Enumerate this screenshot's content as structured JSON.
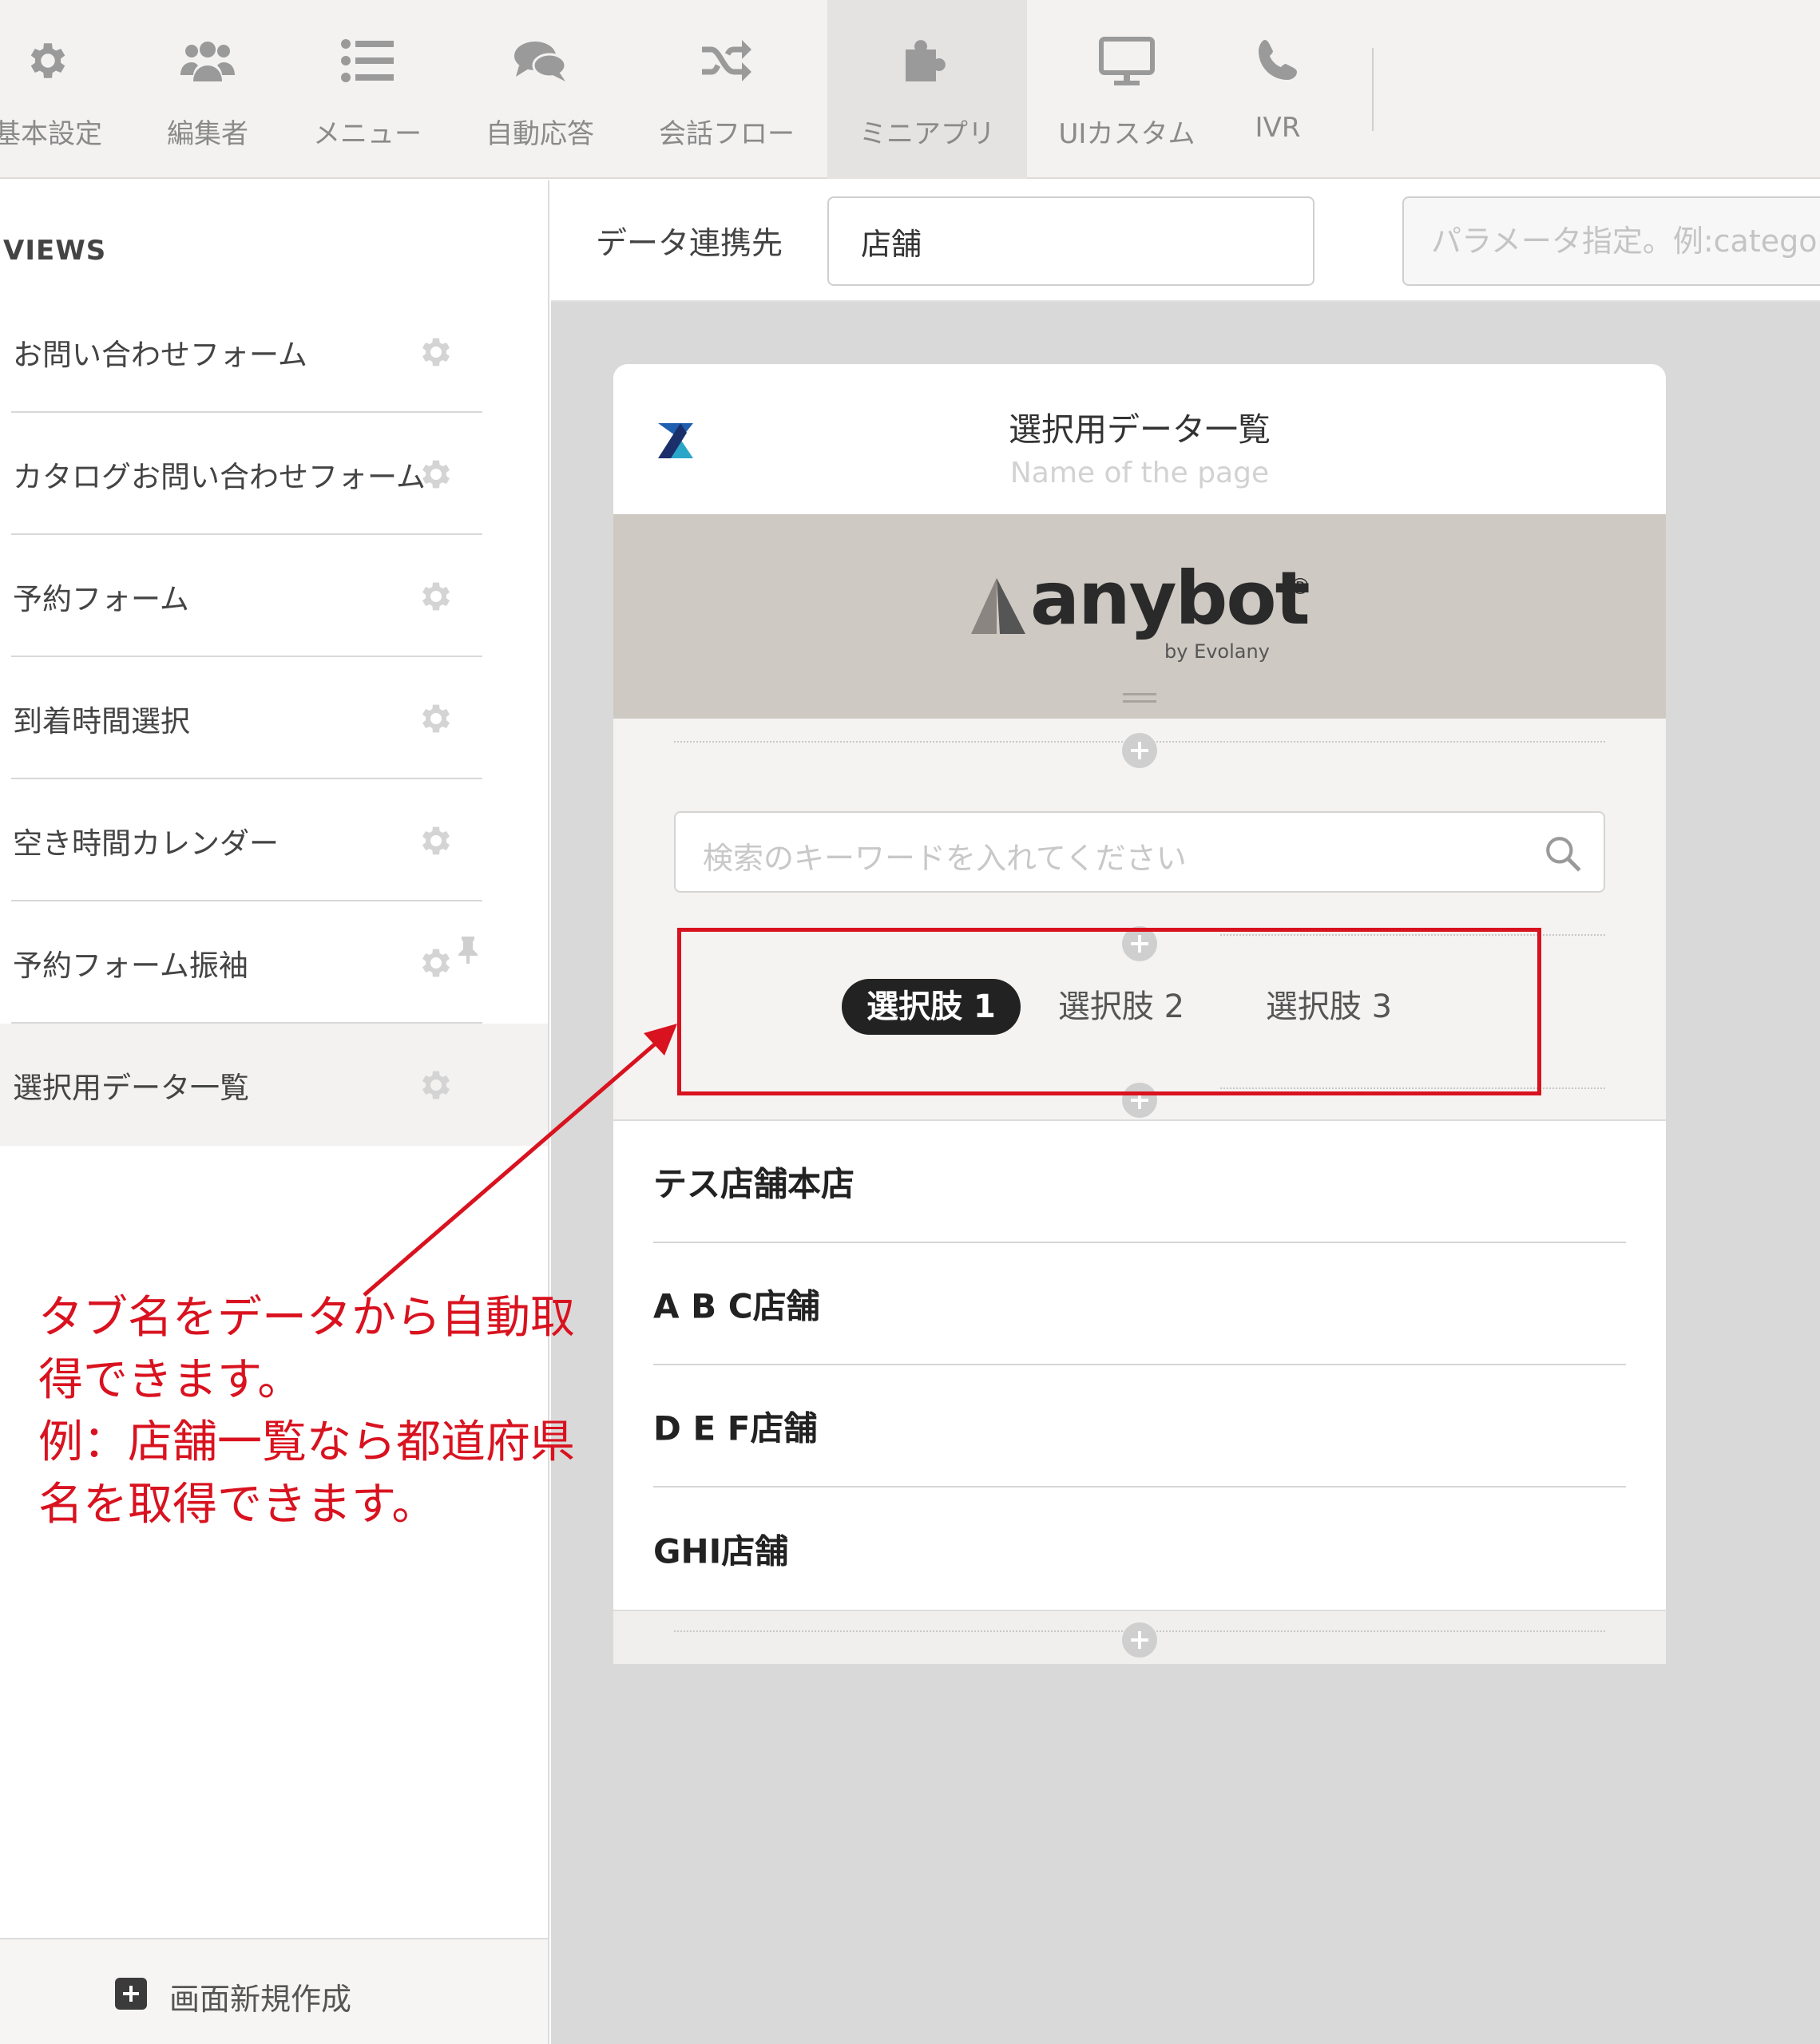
{
  "toolbar": {
    "items": [
      {
        "label": "基本設定",
        "icon": "gear-icon"
      },
      {
        "label": "編集者",
        "icon": "users-icon"
      },
      {
        "label": "メニュー",
        "icon": "list-icon"
      },
      {
        "label": "自動応答",
        "icon": "chat-bubbles-icon"
      },
      {
        "label": "会話フロー",
        "icon": "shuffle-icon"
      },
      {
        "label": "ミニアプリ",
        "icon": "puzzle-icon",
        "active": true
      },
      {
        "label": "UIカスタム",
        "icon": "monitor-icon"
      },
      {
        "label": "IVR",
        "icon": "phone-icon"
      }
    ]
  },
  "sidebar": {
    "title": "VIEWS",
    "items": [
      {
        "label": "お問い合わせフォーム"
      },
      {
        "label": "カタログお問い合わせフォーム"
      },
      {
        "label": "予約フォーム"
      },
      {
        "label": "到着時間選択"
      },
      {
        "label": "空き時間カレンダー"
      },
      {
        "label": "予約フォーム振袖",
        "pinned": true
      },
      {
        "label": "選択用データ一覧",
        "active": true
      }
    ],
    "new_screen_label": "画面新規作成"
  },
  "databar": {
    "label": "データ連携先",
    "value": "店舗",
    "param_placeholder": "パラメータ指定。例:category=おすすめ"
  },
  "preview": {
    "title": "選択用データ一覧",
    "subtitle": "Name of the page",
    "brand": {
      "name": "anybot",
      "reg": "®",
      "by": "by Evolany"
    },
    "search_placeholder": "検索のキーワードを入れてください",
    "tabs": [
      "選択肢 1",
      "選択肢 2",
      "選択肢 3"
    ],
    "active_tab": 0,
    "list": [
      "テス店舗本店",
      "A B C店舗",
      "D E F店舗",
      "GHI店舗"
    ]
  },
  "annotation": {
    "lines": [
      "タブ名をデータから自動取",
      "得できます。",
      "例：店舗一覧なら都道府県",
      "名を取得できます。"
    ],
    "color": "#d9121f"
  }
}
